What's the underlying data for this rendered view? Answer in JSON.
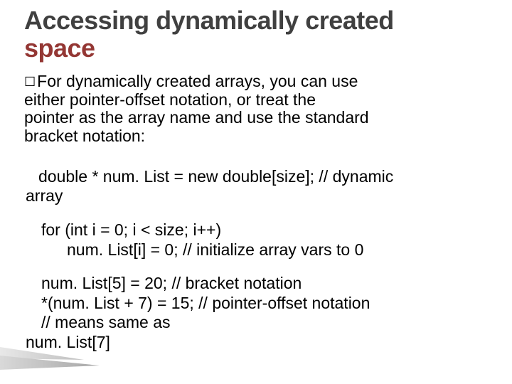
{
  "title": {
    "line1": "Accessing dynamically created",
    "line2_accent": "space"
  },
  "bullet": {
    "checkbox": "☐",
    "lead": "For",
    "rest1": " dynamically created arrays, you can use",
    "line2": "either pointer-offset notation, or treat the",
    "line3": "pointer as the array name and use the standard",
    "line4": "bracket notation:"
  },
  "code": {
    "l1a": "double * num. List = new double[size]; // dynamic",
    "l1b": "array",
    "l2": "for (int i = 0; i < size; i++)",
    "l3": "num. List[i] = 0;       // initialize array vars to 0",
    "l4": "num. List[5] = 20;                  // bracket notation",
    "l5": "*(num. List + 7) = 15;  // pointer-offset notation",
    "l6": "                                //   means same as",
    "l7": "num. List[7]"
  }
}
